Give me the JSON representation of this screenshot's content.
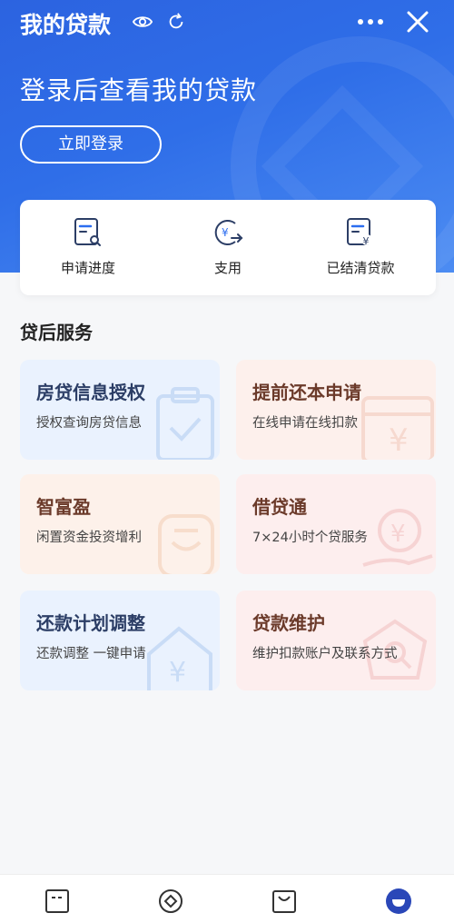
{
  "header": {
    "title": "我的贷款"
  },
  "hero": {
    "prompt": "登录后查看我的贷款",
    "login_label": "立即登录"
  },
  "quick_actions": [
    {
      "label": "申请进度"
    },
    {
      "label": "支用"
    },
    {
      "label": "已结清贷款"
    }
  ],
  "section": {
    "title": "贷后服务"
  },
  "services": [
    {
      "title": "房贷信息授权",
      "subtitle": "授权查询房贷信息"
    },
    {
      "title": "提前还本申请",
      "subtitle": "在线申请在线扣款"
    },
    {
      "title": "智富盈",
      "subtitle": "闲置资金投资增利"
    },
    {
      "title": "借贷通",
      "subtitle": "7×24小时个贷服务"
    },
    {
      "title": "还款计划调整",
      "subtitle": "还款调整 一键申请"
    },
    {
      "title": "贷款维护",
      "subtitle": "维护扣款账户及联系方式"
    }
  ],
  "colors": {
    "brand": "#2c63e0",
    "active_tab": "#2a47b8"
  },
  "bottom_tabs": [
    {
      "icon": "home-icon"
    },
    {
      "icon": "wealth-icon"
    },
    {
      "icon": "shopping-bag-icon"
    },
    {
      "icon": "profile-icon"
    }
  ]
}
